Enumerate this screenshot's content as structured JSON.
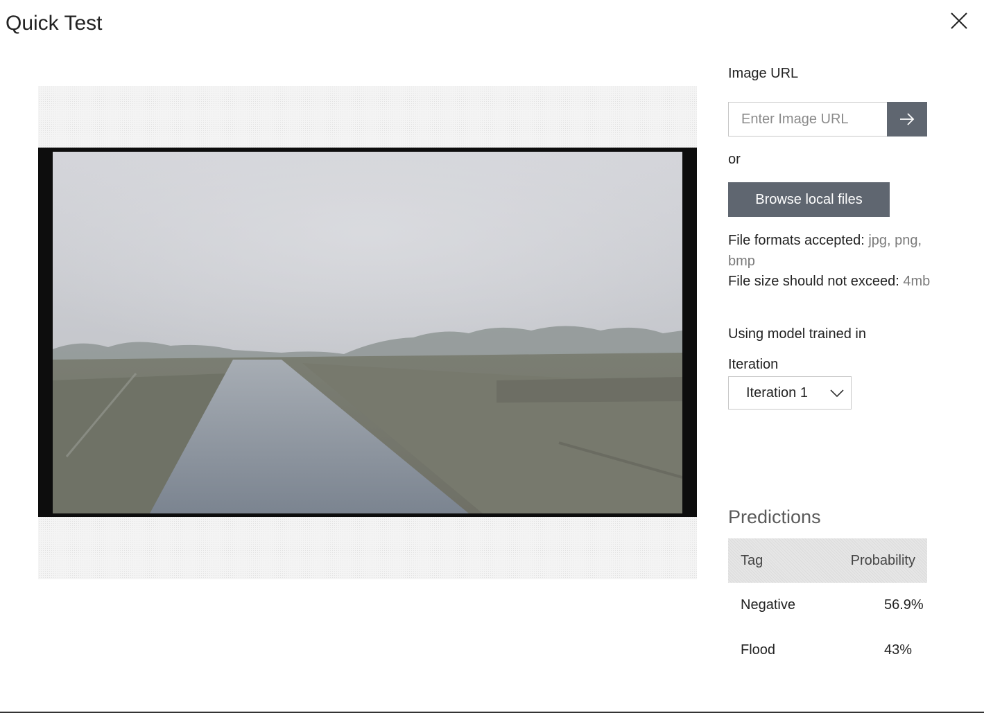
{
  "dialog": {
    "title": "Quick Test",
    "close_label": "Close"
  },
  "preview": {
    "description": "Uploaded test image preview"
  },
  "image_url": {
    "label": "Image URL",
    "placeholder": "Enter Image URL",
    "value": "",
    "submit_icon": "arrow-right-icon"
  },
  "or_text": "or",
  "browse": {
    "label": "Browse local files"
  },
  "file_info": {
    "formats_label": "File formats accepted:",
    "formats_value": "jpg, png, bmp",
    "size_label": "File size should not exceed:",
    "size_value": "4mb"
  },
  "model": {
    "label": "Using model trained in",
    "iteration_label": "Iteration",
    "iteration_selected": "Iteration 1",
    "dropdown_icon": "chevron-down-icon"
  },
  "predictions": {
    "title": "Predictions",
    "columns": [
      "Tag",
      "Probability"
    ],
    "rows": [
      {
        "tag": "Negative",
        "probability": "56.9%"
      },
      {
        "tag": "Flood",
        "probability": "43%"
      }
    ]
  },
  "colors": {
    "button_bg": "#5f6670",
    "border": "#c8c8c8",
    "muted_text": "#7a7a7a"
  }
}
